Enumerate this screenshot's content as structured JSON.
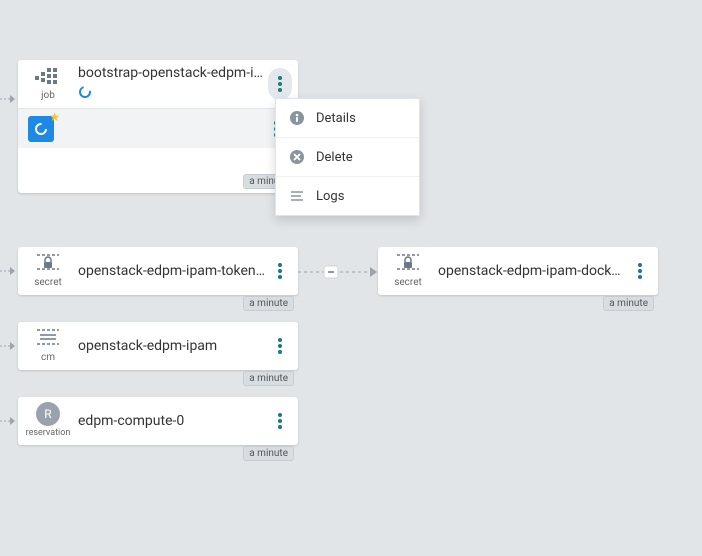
{
  "timestamps": {
    "job": "a minute",
    "secret1": "a minute",
    "secret2": "a minute",
    "cm": "a minute",
    "reservation": "a minute"
  },
  "nodes": {
    "job": {
      "label": "bootstrap-openstack-edpm-ip…",
      "type": "job"
    },
    "secret1": {
      "label": "openstack-edpm-ipam-token-…",
      "type": "secret"
    },
    "secret2": {
      "label": "openstack-edpm-ipam-docke…",
      "type": "secret"
    },
    "cm": {
      "label": "openstack-edpm-ipam",
      "type": "cm"
    },
    "reservation": {
      "label": "edpm-compute-0",
      "type": "reservation",
      "avatar": "R"
    }
  },
  "menu": {
    "details": "Details",
    "delete": "Delete",
    "logs": "Logs"
  }
}
